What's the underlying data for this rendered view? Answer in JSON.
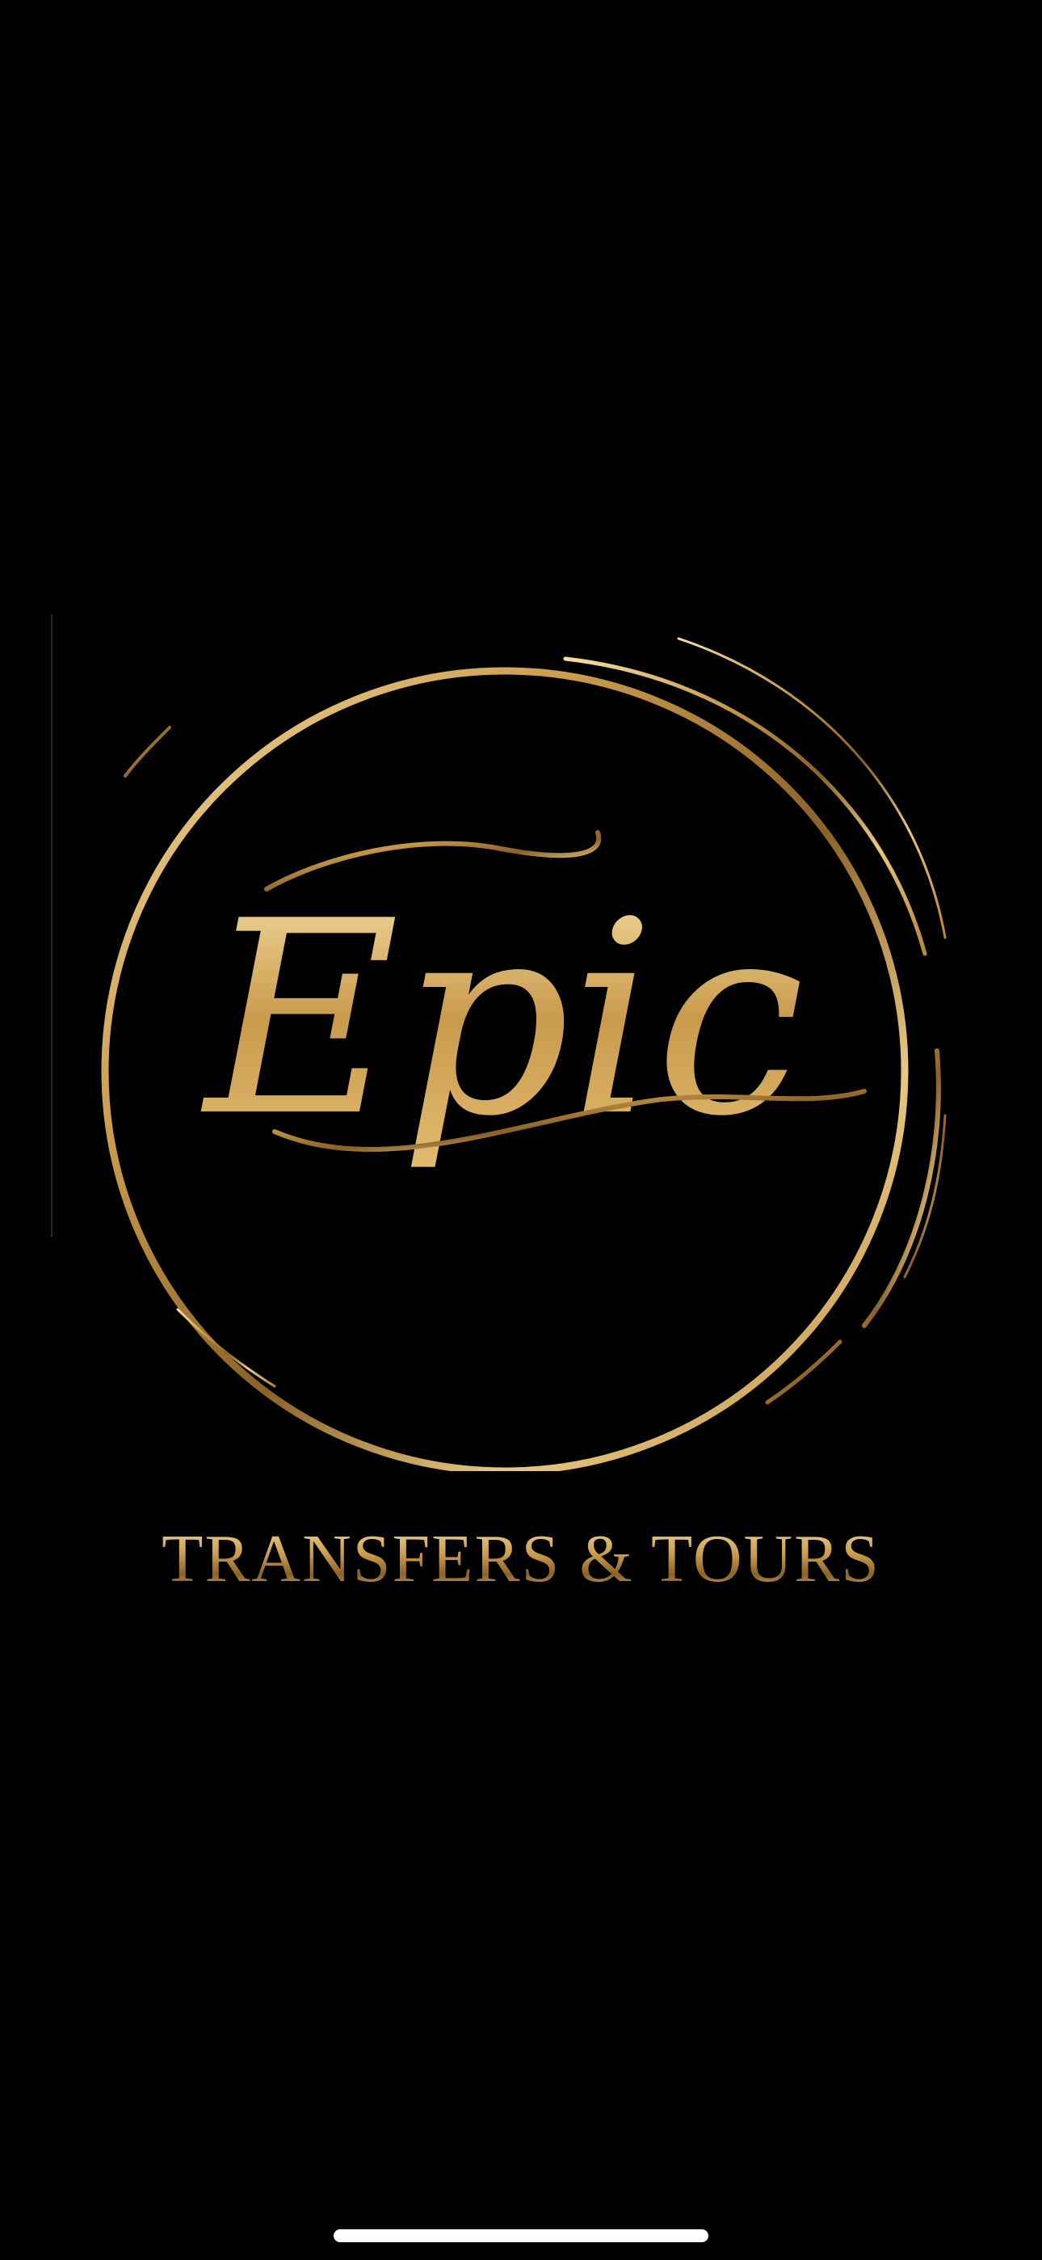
{
  "splash": {
    "brand_name": "Epic",
    "tagline": "TRANSFERS & TOURS"
  },
  "colors": {
    "background": "#000000",
    "gold_light": "#f6dfa0",
    "gold_mid": "#c99a4c",
    "gold_dark": "#8a6127",
    "home_indicator": "#ffffff"
  },
  "icons": {
    "logo": "circle-brush-logo",
    "home_indicator": "home-indicator-bar"
  }
}
